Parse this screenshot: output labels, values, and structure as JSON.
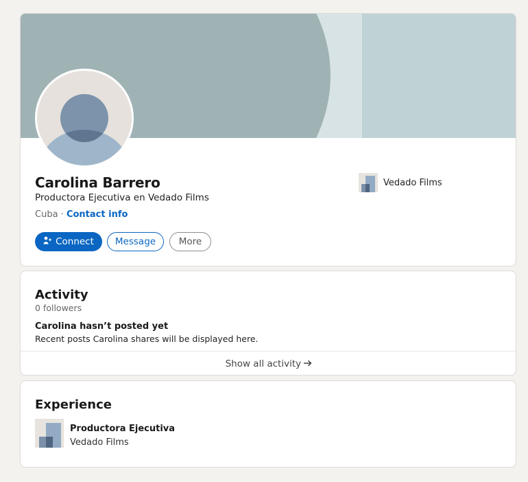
{
  "profile": {
    "name": "Carolina Barrero",
    "headline": "Productora Ejecutiva en Vedado Films",
    "location": "Cuba",
    "separator": " · ",
    "contact_link": "Contact info",
    "current_company": "Vedado Films",
    "avatar_icon": "default-person-icon",
    "buttons": {
      "connect_icon": "add-person-icon",
      "connect": "Connect",
      "message": "Message",
      "more": "More"
    }
  },
  "activity": {
    "title": "Activity",
    "followers": "0 followers",
    "empty_title": "Carolina hasn’t posted yet",
    "empty_subtitle": "Recent posts Carolina shares will be displayed here.",
    "show_all": "Show all activity",
    "arrow_icon": "right-arrow-icon"
  },
  "experience": {
    "title": "Experience",
    "items": [
      {
        "role": "Productora Ejecutiva",
        "company": "Vedado Films"
      }
    ]
  },
  "colors": {
    "accent": "#0a66c2",
    "page_bg": "#f3f2ef",
    "banner_light": "#bfd2d5",
    "banner_dark": "#9fb3b5"
  }
}
